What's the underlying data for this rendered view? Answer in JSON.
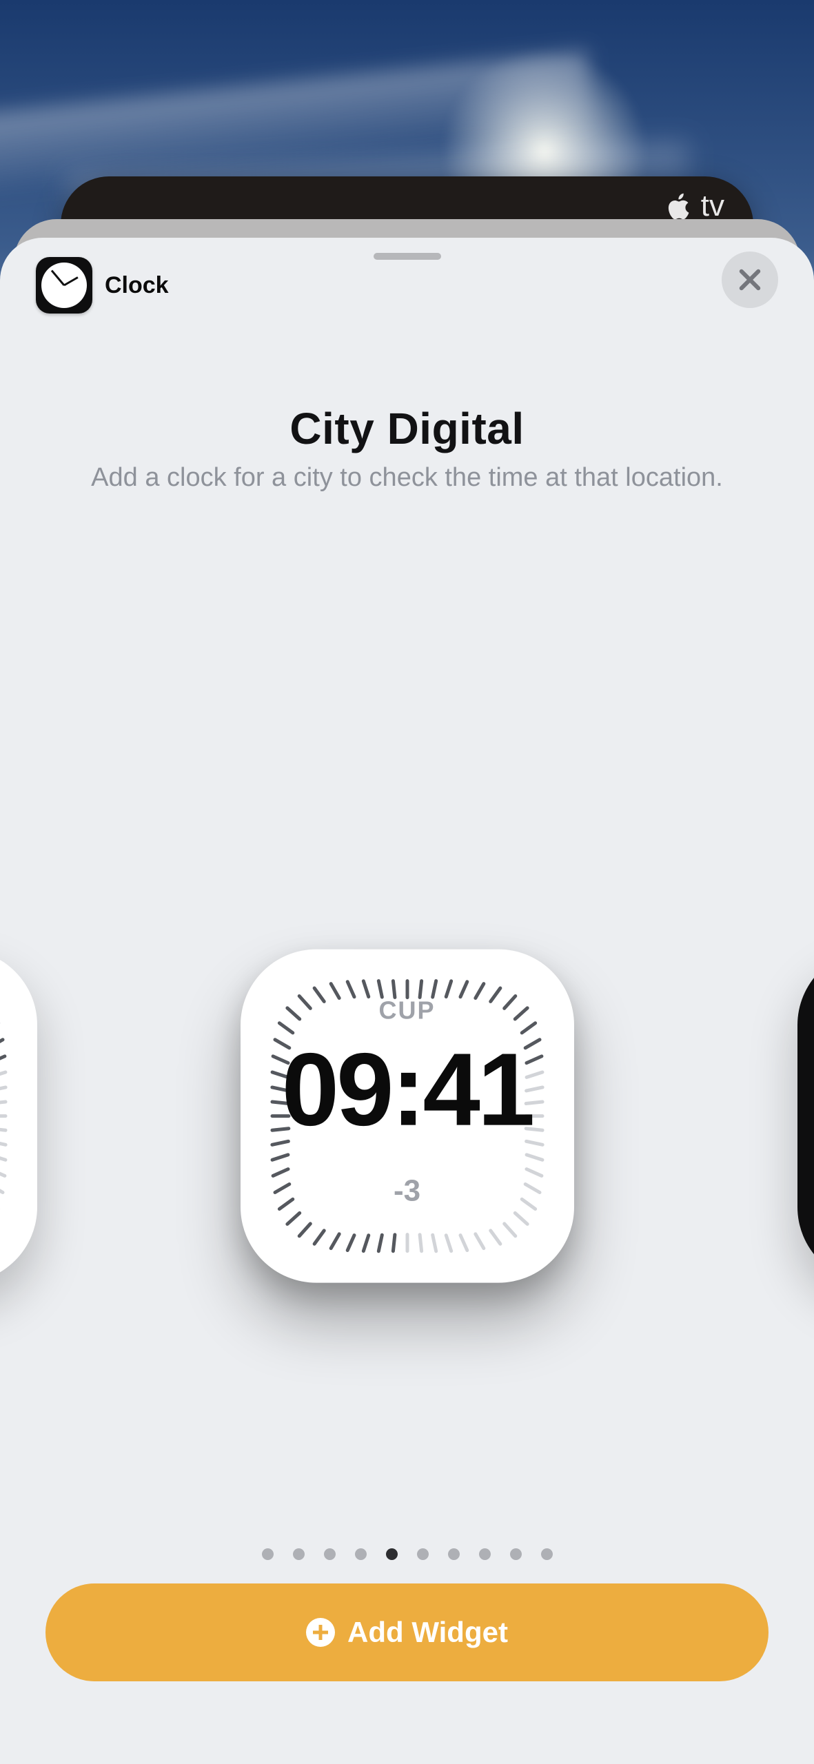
{
  "background": {
    "apple_tv_label": "tv"
  },
  "sheet": {
    "app_name": "Clock",
    "widget_title": "City Digital",
    "widget_description": "Add a clock for a city to check the time at that location.",
    "add_button_label": "Add Widget",
    "pagination": {
      "dot_count": 10,
      "active_index": 4
    }
  },
  "widget_preview": {
    "city_code": "CUP",
    "time": "09:41",
    "offset": "-3"
  },
  "colors": {
    "accent": "#edad3f",
    "sheet_bg": "#eceef1",
    "muted_text": "#8e929a"
  }
}
